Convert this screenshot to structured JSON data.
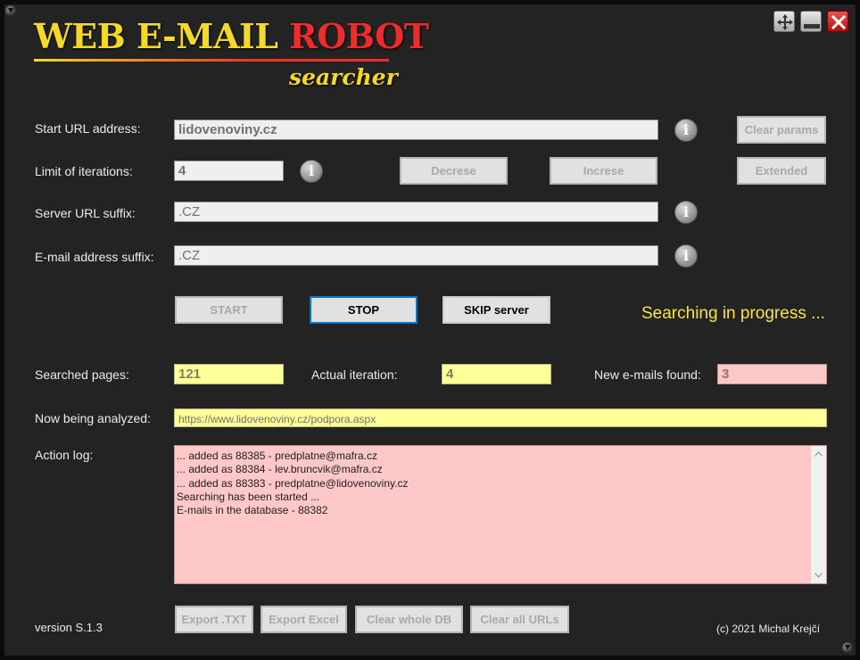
{
  "app": {
    "title_part1": "WEB E-MAIL ",
    "title_part2": "ROBOT",
    "subtitle": "searcher"
  },
  "form": {
    "start_url": {
      "label": "Start URL address:",
      "value": "lidovenoviny.cz"
    },
    "limit": {
      "label": "Limit of iterations:",
      "value": "4"
    },
    "server_suffix": {
      "label": "Server URL suffix:",
      "value": ".CZ"
    },
    "email_suffix": {
      "label": "E-mail address suffix:",
      "value": ".CZ"
    }
  },
  "buttons": {
    "clear_params": "Clear params",
    "decrese": "Decrese",
    "increse": "Increse",
    "extended": "Extended",
    "start": "START",
    "stop": "STOP",
    "skip": "SKIP server"
  },
  "status": "Searching in progress ...",
  "stats": {
    "searched_pages": {
      "label": "Searched pages:",
      "value": "121"
    },
    "actual_iteration": {
      "label": "Actual iteration:",
      "value": "4"
    },
    "new_emails": {
      "label": "New e-mails found:",
      "value": "3"
    }
  },
  "now_analyzed": {
    "label": "Now being analyzed:",
    "value": "https://www.lidovenoviny.cz/podpora.aspx"
  },
  "log": {
    "label": "Action log:",
    "lines": [
      "... added as 88385 - predplatne@mafra.cz",
      "... added as 88384 - lev.bruncvik@mafra.cz",
      "... added as 88383 - predplatne@lidovenoviny.cz",
      "Searching has been started ...",
      "E-mails in the database - 88382"
    ]
  },
  "footer": {
    "version": "version S.1.3",
    "copyright": "(c) 2021 Michal Krejčí",
    "export_txt": "Export .TXT",
    "export_excel": "Export Excel",
    "clear_db": "Clear whole DB",
    "clear_urls": "Clear all URLs"
  },
  "icons": {
    "info": "info-icon",
    "move": "move-icon",
    "minimize": "minimize-icon",
    "close": "close-icon"
  },
  "colors": {
    "accent_yellow": "#f5d928",
    "accent_red": "#ee2c2c",
    "field_yellow": "#ffff99",
    "field_pink": "#ffc8c8"
  }
}
